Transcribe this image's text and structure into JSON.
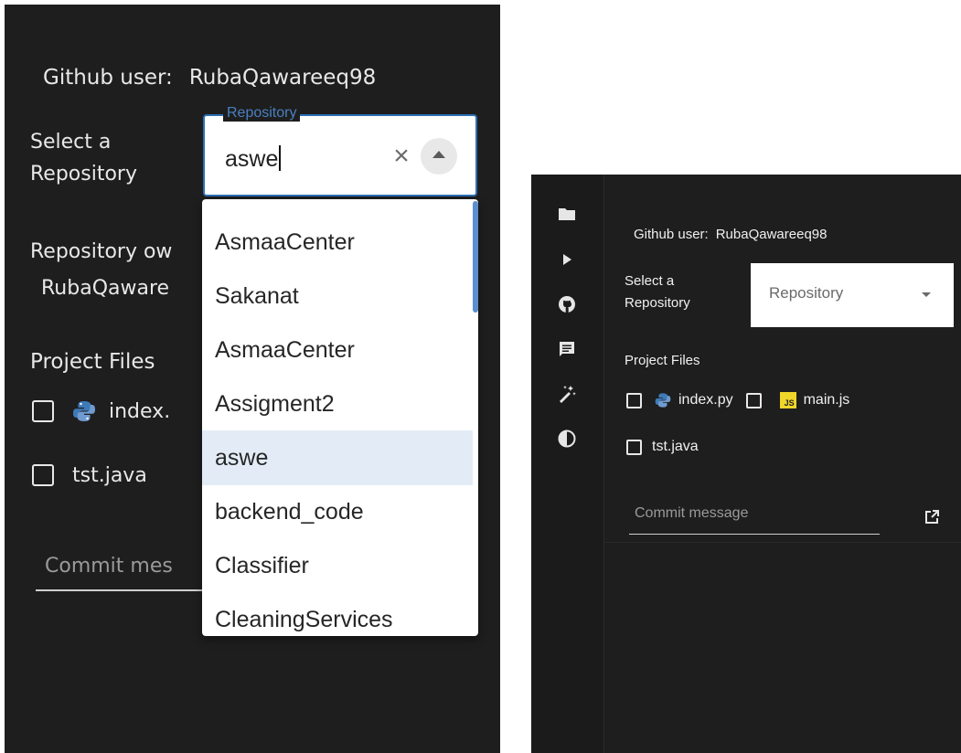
{
  "left_panel": {
    "github_user_label": "Github user:",
    "github_user_value": "RubaQawareeq98",
    "select_repo_label": "Select a Repository",
    "repo_field_legend": "Repository",
    "repo_field_value": "aswe",
    "repo_owner_label": "Repository ow",
    "repo_owner_value": "RubaQaware",
    "project_files_label": "Project Files",
    "file_index_name": "index.",
    "file_tst_name": "tst.java",
    "commit_placeholder": "Commit mes",
    "dropdown_options": [
      {
        "label": "AsmaaCenter",
        "selected": false
      },
      {
        "label": "Sakanat",
        "selected": false
      },
      {
        "label": "AsmaaCenter",
        "selected": false
      },
      {
        "label": "Assigment2",
        "selected": false
      },
      {
        "label": "aswe",
        "selected": true
      },
      {
        "label": "backend_code",
        "selected": false
      },
      {
        "label": "Classifier",
        "selected": false
      },
      {
        "label": "CleaningServices",
        "selected": false
      }
    ]
  },
  "right_panel": {
    "github_user_label": "Github user:",
    "github_user_value": "RubaQawareeq98",
    "select_repo_label": "Select a Repository",
    "repo_placeholder": "Repository",
    "project_files_label": "Project Files",
    "files": [
      {
        "name": "index.py",
        "icon": "python-icon"
      },
      {
        "name": "main.js",
        "icon": "javascript-icon",
        "badge": "JS"
      },
      {
        "name": "tst.java",
        "icon": "none"
      }
    ],
    "commit_placeholder": "Commit message",
    "activity_icons": [
      "folder-icon",
      "play-icon",
      "github-icon",
      "comment-icon",
      "magic-wand-icon",
      "contrast-icon"
    ]
  },
  "colors": {
    "panel_bg": "#1e1e1e",
    "focus_blue": "#2d6fb4",
    "selected_option_bg": "#e3ecf6",
    "js_badge": "#f0d52a"
  }
}
